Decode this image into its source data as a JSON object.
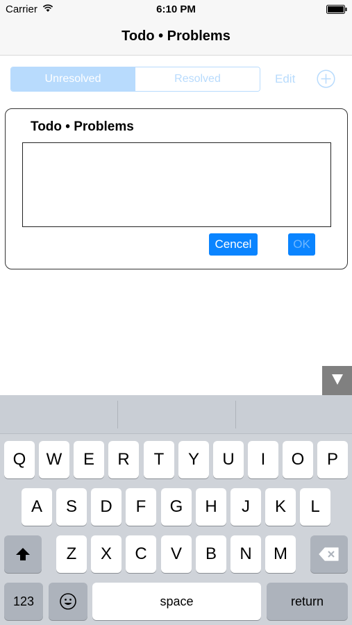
{
  "status_bar": {
    "carrier": "Carrier",
    "time": "6:10 PM"
  },
  "nav": {
    "title": "Todo • Problems"
  },
  "toolbar": {
    "segments": [
      "Unresolved",
      "Resolved"
    ],
    "selected_segment": "Unresolved",
    "edit_label": "Edit",
    "add_icon": "plus-circle-icon"
  },
  "dialog": {
    "title": "Todo • Problems",
    "text_value": "",
    "cancel_label": "Cencel",
    "ok_label": "OK"
  },
  "keyboard": {
    "hide_icon": "triangle-down-icon",
    "row1": [
      "Q",
      "W",
      "E",
      "R",
      "T",
      "Y",
      "U",
      "I",
      "O",
      "P"
    ],
    "row2": [
      "A",
      "S",
      "D",
      "F",
      "G",
      "H",
      "J",
      "K",
      "L"
    ],
    "row3": [
      "Z",
      "X",
      "C",
      "V",
      "B",
      "N",
      "M"
    ],
    "numbers_label": "123",
    "space_label": "space",
    "return_label": "return",
    "shift_icon": "shift-arrow-icon",
    "delete_icon": "backspace-icon",
    "emoji_icon": "emoji-icon"
  },
  "colors": {
    "accent": "#0a84ff",
    "accent_light": "#b8dbfd",
    "keyboard_bg": "#cfd3d9"
  }
}
